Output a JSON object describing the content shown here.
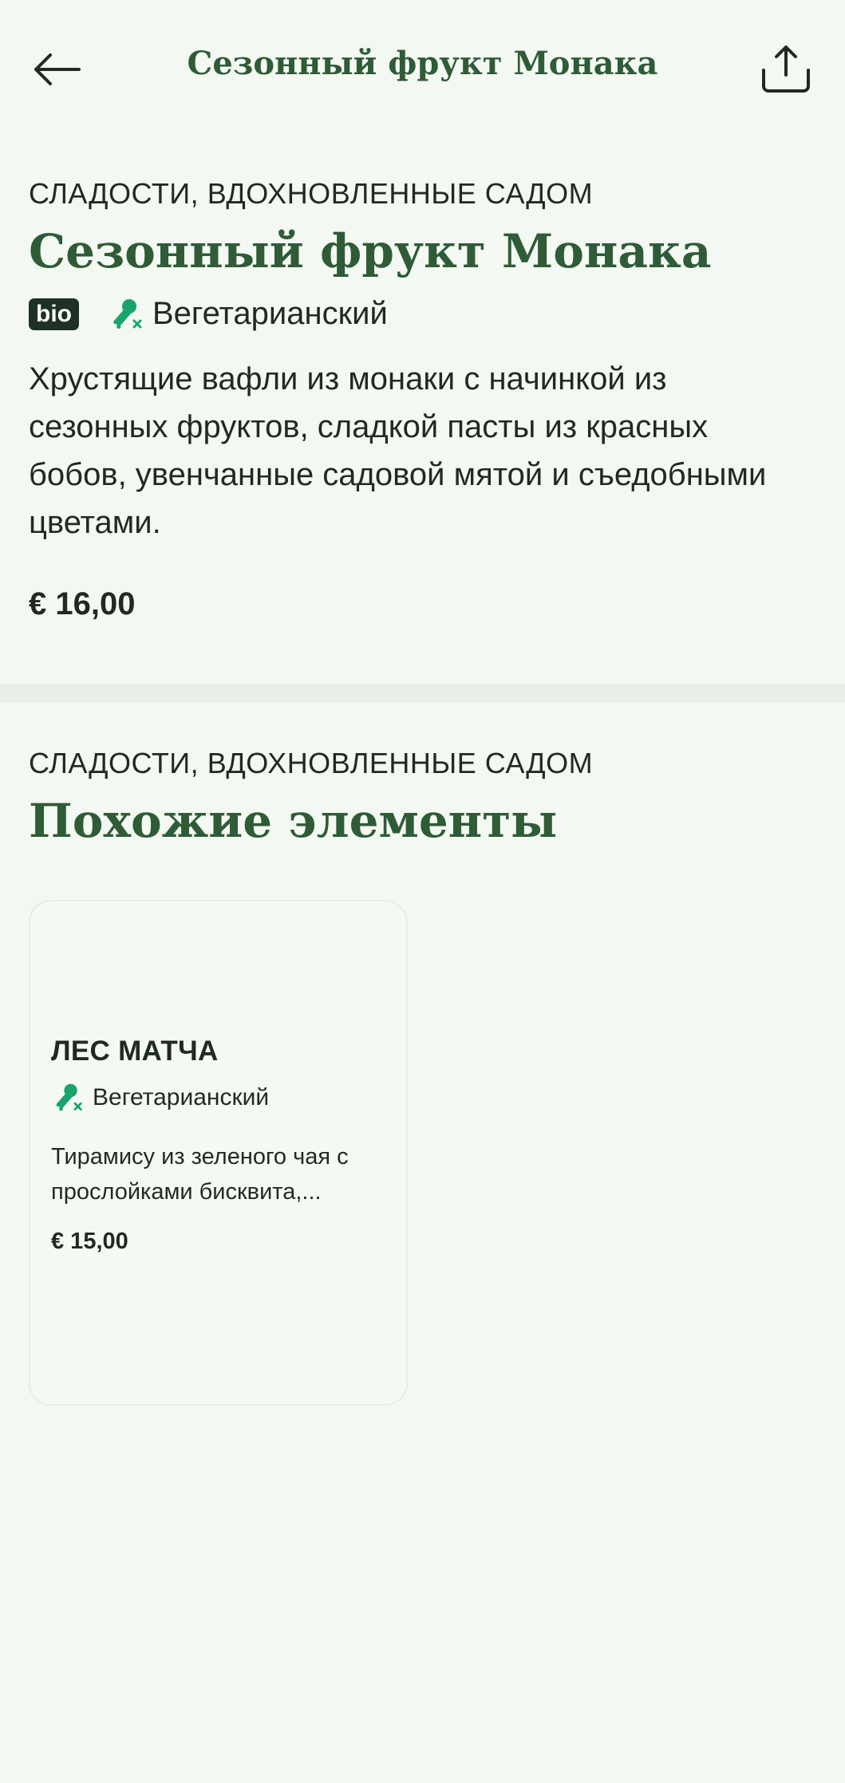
{
  "header": {
    "title": "Сезонный фрукт Монака",
    "back_icon": "arrow-left-icon",
    "share_icon": "share-icon"
  },
  "product": {
    "category": "СЛАДОСТИ, ВДОХНОВЛЕННЫЕ САДОМ",
    "title": "Сезонный фрукт Монака",
    "bio_badge": "bio",
    "diet_label": "Вегетарианский",
    "description": "Хрустящие вафли из монаки с начинкой из сезонных фруктов, сладкой пасты из красных бобов, увенчанные садовой мятой и съедобными цветами.",
    "price": "€ 16,00"
  },
  "similar": {
    "category": "СЛАДОСТИ, ВДОХНОВЛЕННЫЕ САДОМ",
    "title": "Похожие элементы",
    "items": [
      {
        "name": "ЛЕС МАТЧА",
        "diet_label": "Вегетарианский",
        "description": "Тирамису из зеленого чая с прослойками бисквита,...",
        "price": "€ 15,00"
      }
    ]
  },
  "colors": {
    "background": "#f3f8f2",
    "heading_green": "#2f5b37",
    "icon_green": "#1aa36b",
    "badge_dark": "#1e3125"
  }
}
